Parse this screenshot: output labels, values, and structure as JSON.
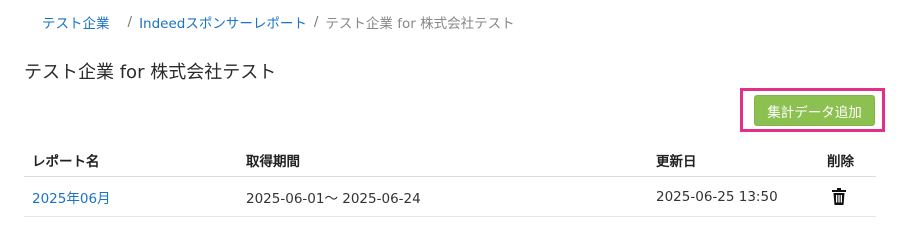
{
  "breadcrumb": {
    "items": [
      {
        "label": "テスト企業"
      },
      {
        "label": "Indeedスポンサーレポート"
      },
      {
        "label": "テスト企業 for 株式会社テスト"
      }
    ],
    "separator": "/"
  },
  "page": {
    "title": "テスト企業 for 株式会社テスト"
  },
  "actions": {
    "add_label": "集計データ追加"
  },
  "table": {
    "columns": {
      "name": "レポート名",
      "period": "取得期間",
      "updated": "更新日",
      "delete": "削除"
    },
    "rows": [
      {
        "name": "2025年06月",
        "period": "2025-06-01～ 2025-06-24",
        "updated": "2025-06-25 13:50",
        "delete_icon": "trash-icon"
      }
    ]
  },
  "colors": {
    "link": "#1a73c8",
    "button_bg": "#8cc152",
    "highlight": "#e0308a"
  }
}
